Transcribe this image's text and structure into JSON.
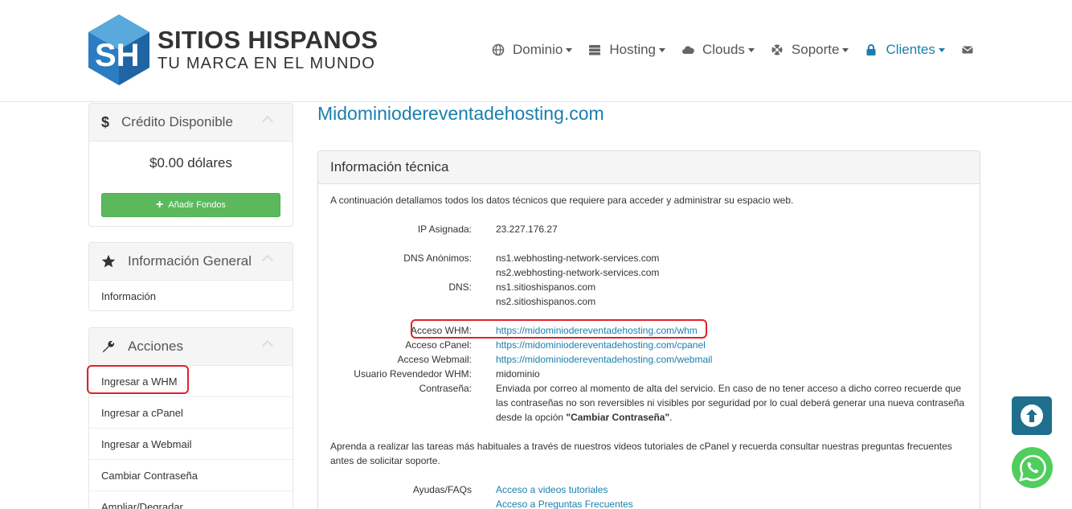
{
  "brand": {
    "name": "SITIOS HISPANOS",
    "tagline": "TU MARCA EN EL MUNDO",
    "colors": {
      "primary": "#1a7fae",
      "logo_blue": "#2b7cc1",
      "logo_light": "#5aa9dd"
    }
  },
  "nav": {
    "items": [
      {
        "label": "Dominio",
        "icon": "globe-icon"
      },
      {
        "label": "Hosting",
        "icon": "server-icon"
      },
      {
        "label": "Clouds",
        "icon": "cloud-icon"
      },
      {
        "label": "Soporte",
        "icon": "lifering-icon"
      },
      {
        "label": "Clientes",
        "icon": "lock-icon",
        "active": true
      }
    ],
    "mail_icon": "envelope-icon"
  },
  "sidebar": {
    "credit": {
      "title": "Crédito Disponible",
      "value": "$0.00 dólares",
      "button": "Añadir Fondos",
      "button_color": "#5cb85c"
    },
    "general": {
      "title": "Información General",
      "items": [
        "Información"
      ]
    },
    "actions": {
      "title": "Acciones",
      "items": [
        "Ingresar a WHM",
        "Ingresar a cPanel",
        "Ingresar a Webmail",
        "Cambiar Contraseña",
        "Ampliar/Degradar"
      ]
    }
  },
  "main": {
    "page_title": "Midominiodereventadehosting.com",
    "panel_title": "Información técnica",
    "intro": "A continuación detallamos todos los datos técnicos que requiere para acceder y administrar su espacio web.",
    "ip_label": "IP Asignada:",
    "ip_value": "23.227.176.27",
    "dns_anon_label": "DNS Anónimos:",
    "dns_anon": [
      "ns1.webhosting-network-services.com",
      "ns2.webhosting-network-services.com"
    ],
    "dns_label": "DNS:",
    "dns": [
      "ns1.sitioshispanos.com",
      "ns2.sitioshispanos.com"
    ],
    "whm_label": "Acceso WHM:",
    "whm_url": "https://midominiodereventadehosting.com/whm",
    "cpanel_label": "Acceso cPanel:",
    "cpanel_url": "https://midominiodereventadehosting.com/cpanel",
    "webmail_label": "Acceso Webmail:",
    "webmail_url": "https://midominiodereventadehosting.com/webmail",
    "user_label": "Usuario Revendedor WHM:",
    "user_value": "midominio",
    "pass_label": "Contraseña:",
    "pass_text_1": "Enviada por correo al momento de alta del servicio. En caso de no tener acceso a dicho correo recuerde que las contraseñas no son reversibles ni visibles por seguridad por lo cual deberá generar una nueva contraseña desde la opción ",
    "pass_text_bold": "\"Cambiar Contraseña\"",
    "pass_text_2": ".",
    "tutorials_text": "Aprenda a realizar las tareas más habituales a través de nuestros videos tutoriales de cPanel y recuerda consultar nuestras preguntas frecuentes antes de solicitar soporte.",
    "help_label": "Ayudas/FAQs",
    "help_links": [
      "Acceso a videos tutoriales",
      "Acceso a Preguntas Frecuentes"
    ]
  },
  "floating": {
    "scroll_top_icon": "arrow-up-circle-icon",
    "whatsapp_icon": "whatsapp-icon",
    "scroll_color": "#1f6e8c",
    "whatsapp_color": "#4fce5d"
  },
  "highlight_color": "#e0212b"
}
